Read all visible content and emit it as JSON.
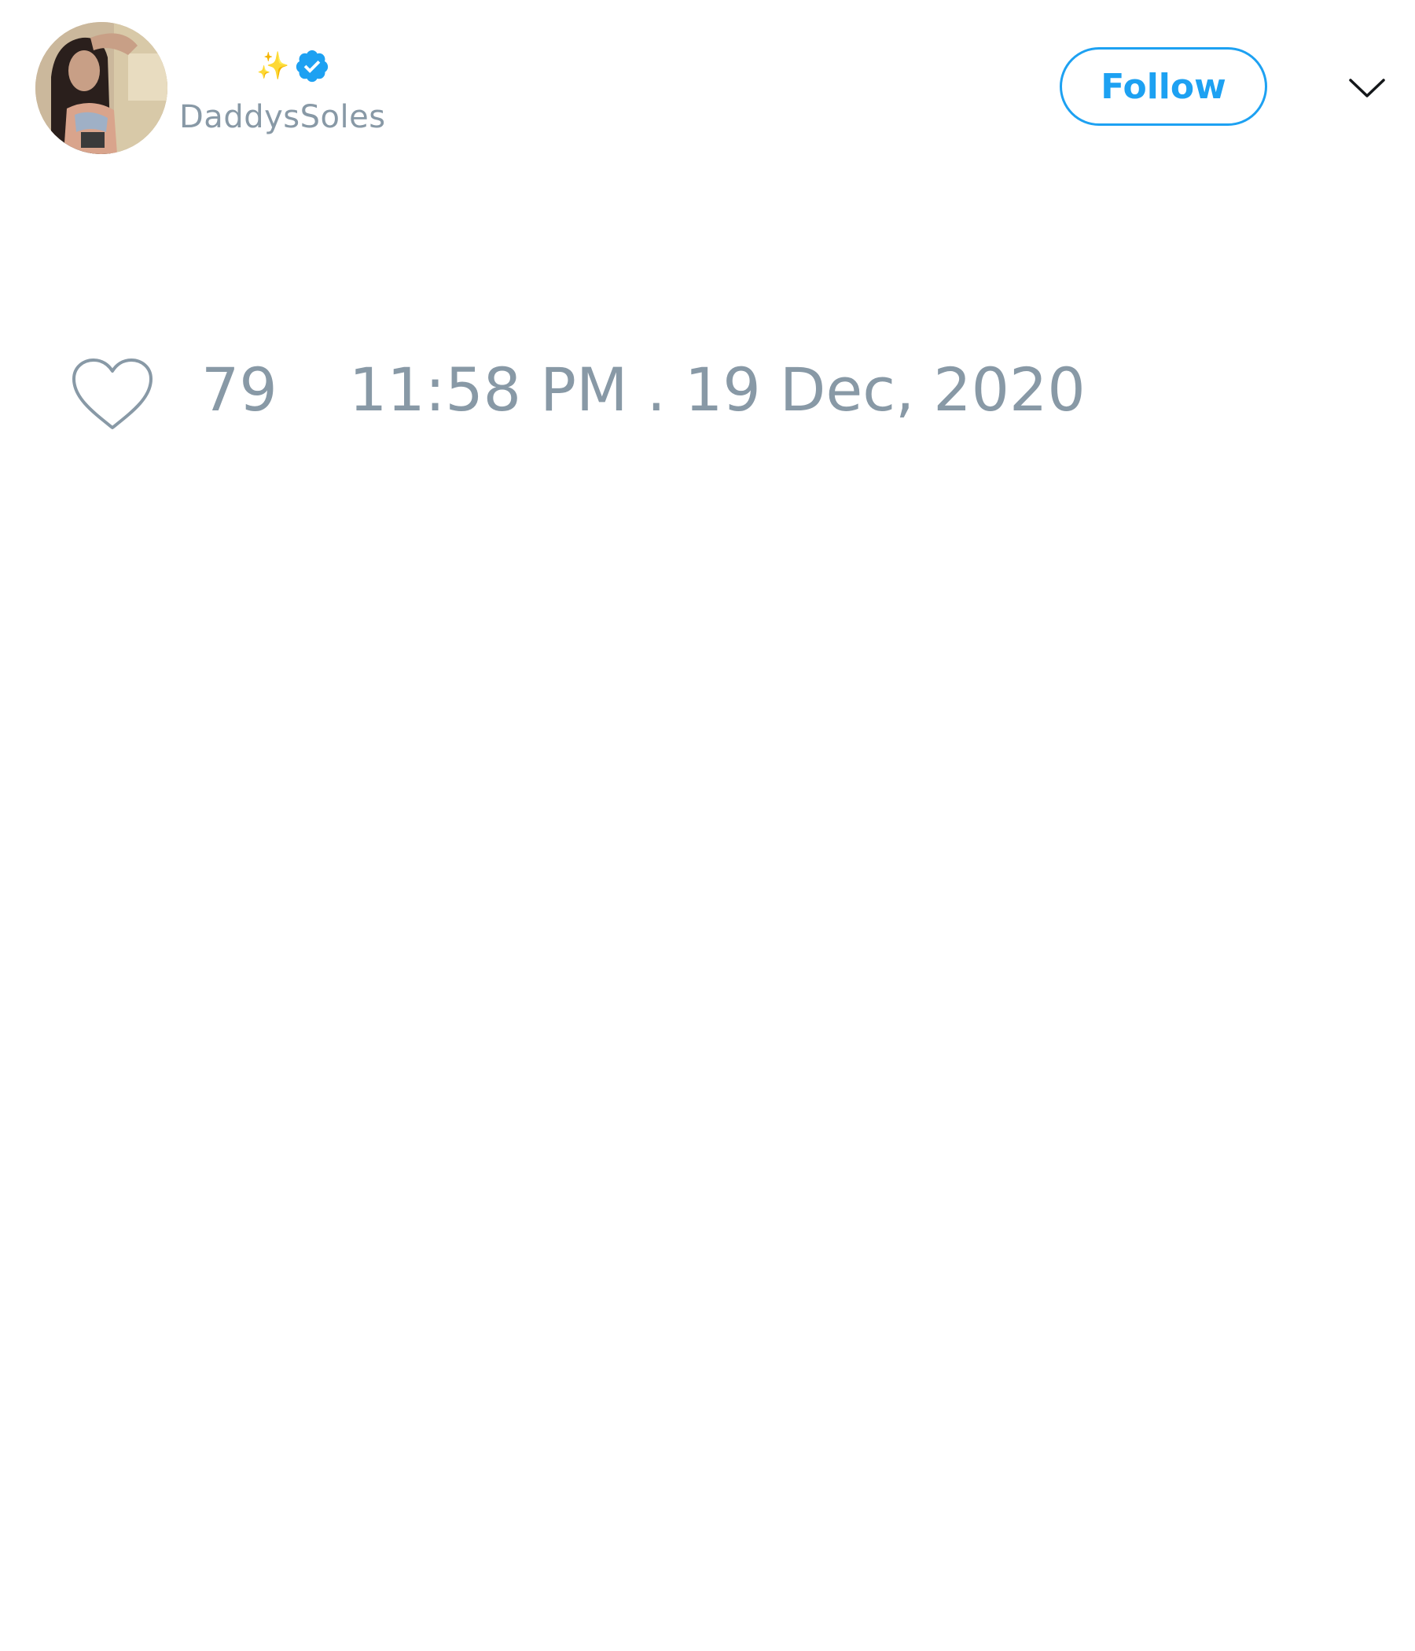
{
  "author": {
    "name_emoji": "✨",
    "verified": true,
    "handle": "DaddysSoles"
  },
  "actions": {
    "follow_label": "Follow",
    "menu_icon": "chevron-down-icon"
  },
  "tweet_meta": {
    "like_icon": "heart-icon",
    "like_count": "79",
    "timestamp": "11:58 PM . 19 Dec, 2020"
  },
  "colors": {
    "accent": "#1da1f2",
    "muted_text": "#8899a6",
    "background": "#ffffff"
  }
}
